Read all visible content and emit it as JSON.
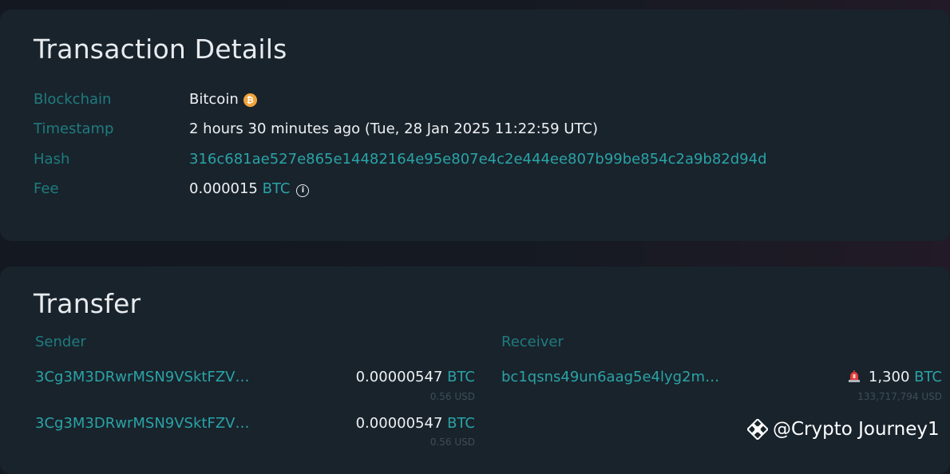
{
  "details": {
    "title": "Transaction Details",
    "rows": [
      {
        "label": "Blockchain",
        "value": "Bitcoin"
      },
      {
        "label": "Timestamp",
        "value": "2 hours 30 minutes ago (Tue, 28 Jan 2025 11:22:59 UTC)"
      },
      {
        "label": "Hash",
        "value": "316c681ae527e865e14482164e95e807e4c2e444ee807b99be854c2a9b82d94d"
      },
      {
        "label": "Fee",
        "value": "0.000015",
        "unit": "BTC"
      }
    ],
    "coin_symbol": "₿",
    "info_symbol": "i"
  },
  "transfer": {
    "title": "Transfer",
    "sender_label": "Sender",
    "receiver_label": "Receiver",
    "senders": [
      {
        "address": "3Cg3M3DRwrMSN9VSktFZV…",
        "amount": "0.00000547",
        "unit": "BTC",
        "usd": "0.56 USD"
      },
      {
        "address": "3Cg3M3DRwrMSN9VSktFZV…",
        "amount": "0.00000547",
        "unit": "BTC",
        "usd": "0.56 USD"
      }
    ],
    "receivers": [
      {
        "address": "bc1qsns49un6aag5e4lyg2m…",
        "amount": "1,300",
        "unit": "BTC",
        "usd": "133,717,794 USD",
        "icon": "alarm-icon"
      }
    ]
  },
  "watermark": {
    "text": "@Crypto Journey1",
    "icon": "binance-logo-icon"
  },
  "colors": {
    "accent": "#2aa3a6",
    "label": "#1e7c7f",
    "card": "#19232c",
    "coin": "#f2a33a"
  }
}
